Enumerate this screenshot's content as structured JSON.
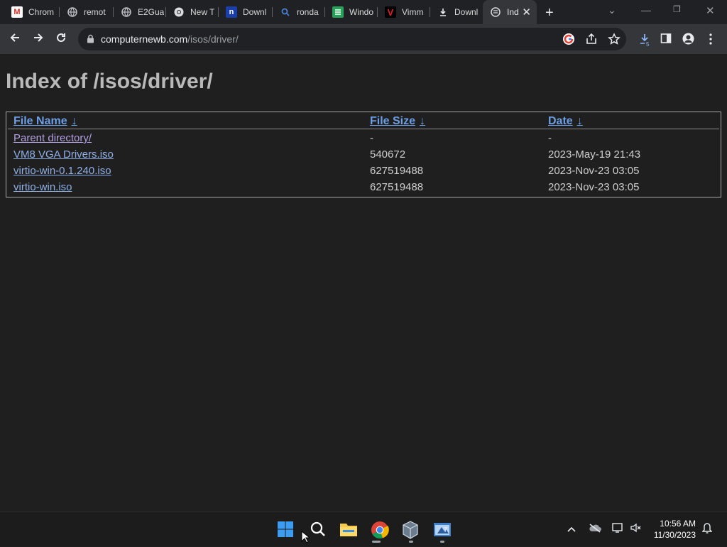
{
  "tabs": [
    {
      "title": "Chrom",
      "icon": "gmail-icon"
    },
    {
      "title": "remot",
      "icon": "globe-icon"
    },
    {
      "title": "E2Gua",
      "icon": "globe-icon"
    },
    {
      "title": "New T",
      "icon": "chrome-icon"
    },
    {
      "title": "Downl",
      "icon": "n-logo-icon"
    },
    {
      "title": "ronda",
      "icon": "search-icon"
    },
    {
      "title": "Windo",
      "icon": "green-logo-icon"
    },
    {
      "title": "Vimm",
      "icon": "vimm-logo-icon"
    },
    {
      "title": "Downl",
      "icon": "download-icon"
    },
    {
      "title": "Ind",
      "icon": "page-icon",
      "active": true
    }
  ],
  "toolbar": {
    "url_host": "computernewb.com",
    "url_path": "/isos/driver/"
  },
  "page": {
    "heading": "Index of /isos/driver/",
    "columns": {
      "name": "File Name",
      "size": "File Size",
      "date": "Date",
      "sort_arrow": "↓"
    },
    "rows": [
      {
        "name": "Parent directory/",
        "size": "-",
        "date": "-"
      },
      {
        "name": "VM8 VGA Drivers.iso",
        "size": "540672",
        "date": "2023-May-19 21:43"
      },
      {
        "name": "virtio-win-0.1.240.iso",
        "size": "627519488",
        "date": "2023-Nov-23 03:05"
      },
      {
        "name": "virtio-win.iso",
        "size": "627519488",
        "date": "2023-Nov-23 03:05"
      }
    ]
  },
  "taskbar": {
    "time": "10:56 AM",
    "date": "11/30/2023"
  },
  "colors": {
    "background": "#1f1f1f",
    "link": "#8fb0e6",
    "visited_link": "#b4a0e0",
    "header_link": "#6d9fe6"
  }
}
